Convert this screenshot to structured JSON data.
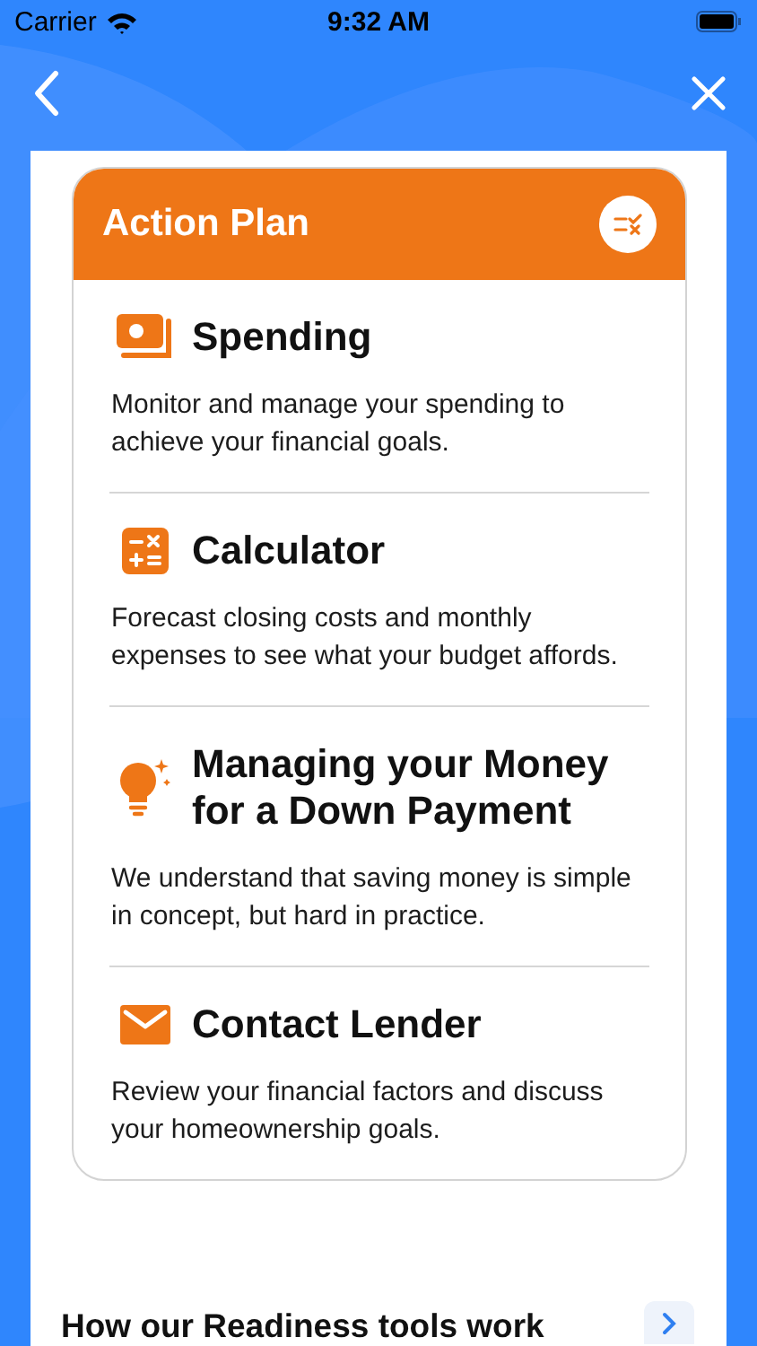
{
  "status_bar": {
    "carrier": "Carrier",
    "time": "9:32 AM"
  },
  "card": {
    "title": "Action Plan",
    "items": [
      {
        "kind": "spending",
        "title": "Spending",
        "description": "Monitor and manage your spending to achieve your financial goals."
      },
      {
        "kind": "calculator",
        "title": "Calculator",
        "description": "Forecast closing costs and monthly expenses to see what your budget affords."
      },
      {
        "kind": "idea",
        "title": "Managing your Money for a Down Payment",
        "description": "We understand that saving money is simple in concept, but hard in practice."
      },
      {
        "kind": "mail",
        "title": "Contact Lender",
        "description": "Review your financial factors and discuss your homeownership goals."
      }
    ]
  },
  "footer": {
    "title": "How our Readiness tools work"
  }
}
